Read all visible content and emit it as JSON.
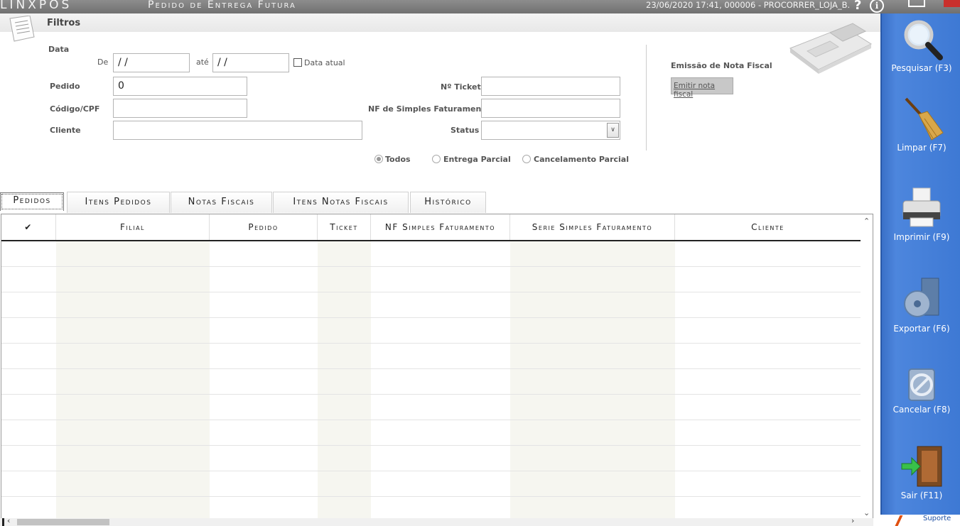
{
  "titlebar": {
    "brand": "LINXPOS",
    "title": "Pedido de Entrega Futura",
    "session": "23/06/2020 17:41, 000006 - PROCORRER_LOJA_B.",
    "help": "?",
    "info": "i"
  },
  "filters": {
    "title": "Filtros",
    "date_label": "Data",
    "from_label": "De",
    "from_value": " /  /",
    "to_label": "até",
    "to_value": " /  /",
    "current_date_label": "Data atual",
    "order_label": "Pedido",
    "order_value": "0",
    "code_label": "Código/CPF",
    "code_value": "",
    "client_label": "Cliente",
    "client_value": "",
    "ticket_label": "Nº Ticket",
    "ticket_value": "",
    "nf_label": "NF de Simples Faturamento",
    "nf_value": "",
    "status_label": "Status",
    "status_value": "",
    "radio_all": "Todos",
    "radio_partial": "Entrega Parcial",
    "radio_cancel": "Cancelamento Parcial",
    "selected_radio": "Todos"
  },
  "invoice": {
    "title": "Emissão de Nota Fiscal",
    "button": "Emitir nota fiscal"
  },
  "tabs": [
    {
      "label": "Pedidos",
      "active": true
    },
    {
      "label": "Itens Pedidos",
      "active": false
    },
    {
      "label": "Notas Fiscais",
      "active": false
    },
    {
      "label": "Itens Notas Fiscais",
      "active": false
    },
    {
      "label": "Histórico",
      "active": false
    }
  ],
  "grid": {
    "columns": [
      "✔",
      "Filial",
      "Pedido",
      "Ticket",
      "NF Simples Faturamento",
      "Serie Simples Faturamento",
      "Cliente"
    ],
    "rows": []
  },
  "sidebar": {
    "search": "Pesquisar (F3)",
    "clear": "Limpar (F7)",
    "print": "Imprimir (F9)",
    "export": "Exportar (F6)",
    "cancel": "Cancelar (F8)",
    "exit": "Sair (F11)"
  },
  "footer": {
    "support": "Suporte"
  },
  "colors": {
    "sidebar": "#3e79d4",
    "titlebar": "#7a7a7a",
    "column_shade": "#f6f6f0"
  }
}
